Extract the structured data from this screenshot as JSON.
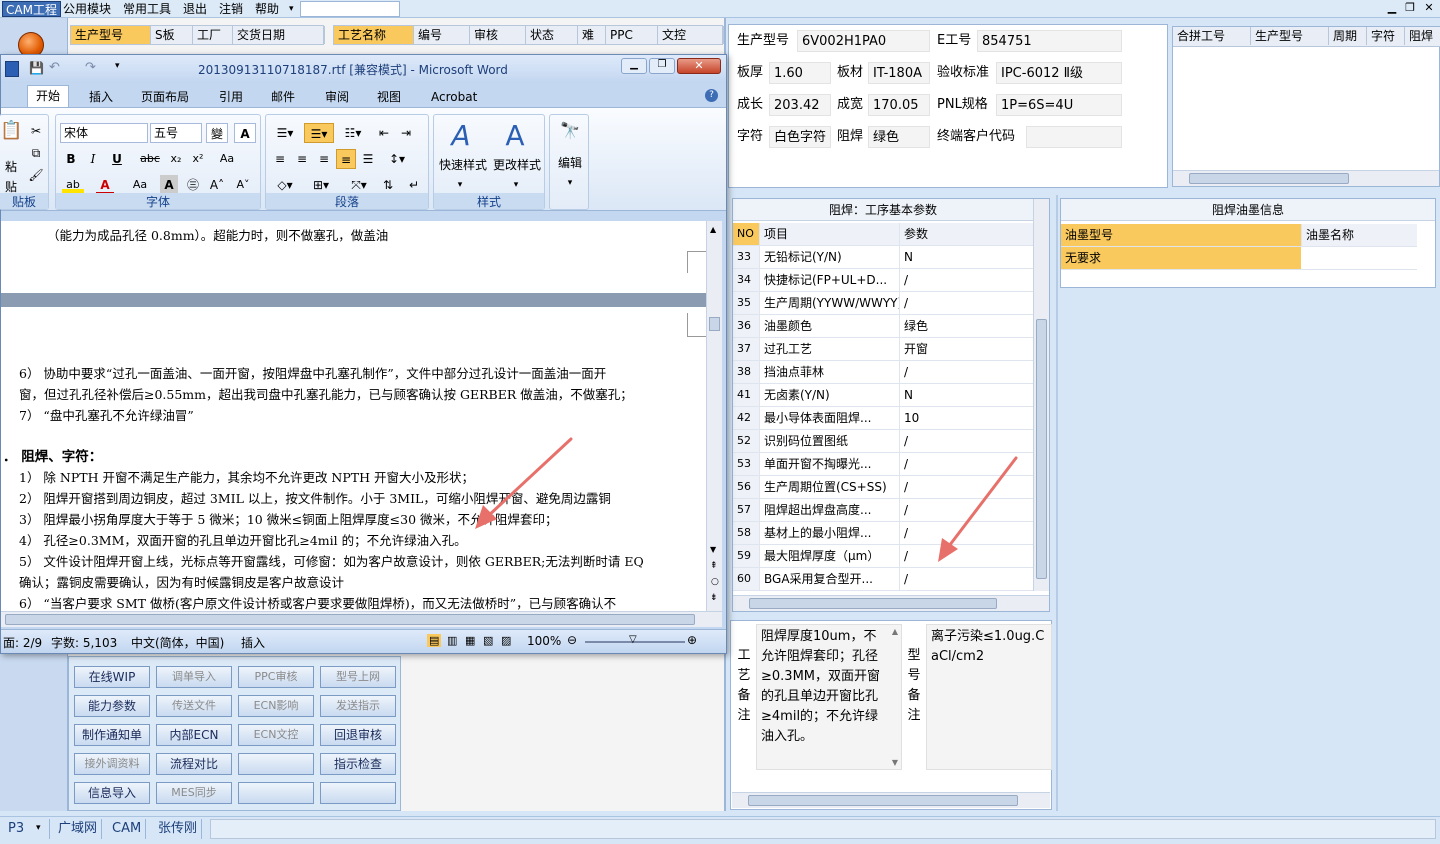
{
  "menubar": {
    "items": [
      "CAM工程",
      "公用模块",
      "常用工具",
      "退出",
      "注销",
      "帮助"
    ]
  },
  "top_grid_left": {
    "headers": [
      "生产型号",
      "S板",
      "工厂",
      "交货日期"
    ]
  },
  "top_grid_right": {
    "headers": [
      "工艺名称",
      "编号",
      "审核",
      "状态",
      "难",
      "PPC",
      "文控"
    ]
  },
  "bottom_buttons": {
    "rows": [
      [
        "在线WIP",
        "调单导入",
        "PPC审核",
        "型号上网"
      ],
      [
        "能力参数",
        "传送文件",
        "ECN影响",
        "发送指示"
      ],
      [
        "制作通知单",
        "内部ECN",
        "ECN文控",
        "回退审核"
      ],
      [
        "接外调资料",
        "流程对比",
        "",
        ""
      ],
      [
        "信息导入",
        "MES同步",
        "",
        ""
      ]
    ],
    "extra": "指示检查"
  },
  "word": {
    "title": "20130913110718187.rtf [兼容模式] - Microsoft Word",
    "tabs": [
      "开始",
      "插入",
      "页面布局",
      "引用",
      "邮件",
      "审阅",
      "视图",
      "Acrobat"
    ],
    "font_name": "宋体",
    "font_size": "五号",
    "group_labels": [
      "贴板",
      "字体",
      "段落",
      "样式"
    ],
    "style_btns": [
      "快速样式",
      "更改样式",
      "编辑"
    ],
    "paste_label": "粘贴",
    "doc_lines": [
      "（能力为成品孔径 0.8mm）。超能力时，则不做塞孔，做盖油",
      "6）  协助中要求“过孔一面盖油、一面开窗，按阻焊盘中孔塞孔制作”，文件中部分过孔设计一面盖油一面开",
      "      窗，但过孔孔径补偿后≥0.55mm，超出我司盘中孔塞孔能力，已与顾客确认按 GERBER 做盖油，不做塞孔；",
      "7）  “盘中孔塞孔不允许绿油冒”",
      "．  阻焊、字符：",
      "1）  除 NPTH 开窗不满足生产能力，其余均不允许更改 NPTH 开窗大小及形状；",
      "2）  阻焊开窗搭到周边铜皮，超过 3MIL 以上，按文件制作。小于 3MIL，可缩小阻焊开窗、避免周边露铜",
      "3）  阻焊最小拐角厚度大于等于 5 微米；10 微米≤铜面上阻焊厚度≤30 微米，不允许阻焊套印；",
      "4）  孔径≥0.3MM，双面开窗的孔且单边开窗比孔≥4mil 的；不允许绿油入孔。",
      "5）  文件设计阻焊开窗上线，光标点等开窗露线，可修窗：如为客户故意设计，则依 GERBER;无法判断时请 EQ",
      "      确认；露铜皮需要确认，因为有时候露铜皮是客户故意设计",
      "6）  “当客户要求 SMT 做桥(客户原文件设计桥或客户要求要做阻焊桥)，而又无法做桥时”，已与顾客确认不"
    ],
    "status": {
      "page": "面: 2/9",
      "words": "字数: 5,103",
      "lang": "中文(简体，中国)",
      "mode": "插入",
      "zoom": "100%"
    }
  },
  "info": {
    "fields": [
      {
        "label": "生产型号",
        "value": "6V002H1PA0"
      },
      {
        "label": "E工号",
        "value": "854751"
      },
      {
        "label": "板厚",
        "value": "1.60"
      },
      {
        "label": "板材",
        "value": "IT-180A"
      },
      {
        "label": "验收标准",
        "value": "IPC-6012 Ⅱ级"
      },
      {
        "label": "成长",
        "value": "203.42"
      },
      {
        "label": "成宽",
        "value": "170.05"
      },
      {
        "label": "PNL规格",
        "value": "1P=6S=4U"
      },
      {
        "label": "字符",
        "value": "白色字符"
      },
      {
        "label": "阻焊",
        "value": "绿色"
      },
      {
        "label": "终端客户代码",
        "value": ""
      }
    ]
  },
  "merge_grid": {
    "headers": [
      "合拼工号",
      "生产型号",
      "周期",
      "字符",
      "阻焊"
    ]
  },
  "process_params": {
    "title": "阻焊：工序基本参数",
    "headers": [
      "NO",
      "项目",
      "参数"
    ],
    "rows": [
      [
        "33",
        "无铅标记(Y/N)",
        "N"
      ],
      [
        "34",
        "快捷标记(FP+UL+D...",
        "/"
      ],
      [
        "35",
        "生产周期(YYWW/WWYY)",
        "/"
      ],
      [
        "36",
        "油墨颜色",
        "绿色"
      ],
      [
        "37",
        "过孔工艺",
        "开窗"
      ],
      [
        "38",
        "挡油点菲林",
        "/"
      ],
      [
        "41",
        "无卤素(Y/N)",
        "N"
      ],
      [
        "42",
        "最小导体表面阻焊...",
        "10"
      ],
      [
        "52",
        "识别码位置图纸",
        "/"
      ],
      [
        "53",
        "单面开窗不掏曝光...",
        "/"
      ],
      [
        "56",
        "生产周期位置(CS+SS)",
        "/"
      ],
      [
        "57",
        "阻焊超出焊盘高度...",
        "/"
      ],
      [
        "58",
        "基材上的最小阻焊...",
        "/"
      ],
      [
        "59",
        "最大阻焊厚度（μm）",
        "/"
      ],
      [
        "60",
        "BGA采用复合型开...",
        "/"
      ]
    ]
  },
  "ink_info": {
    "title": "阻焊油墨信息",
    "headers": [
      "油墨型号",
      "油墨名称"
    ],
    "row": [
      "无要求",
      ""
    ]
  },
  "process_note": {
    "label": "工艺备注",
    "text": "阻焊厚度10um，不允许阻焊套印；孔径≥0.3MM，双面开窗的孔且单边开窗比孔≥4mil的；不允许绿油入孔。"
  },
  "model_note": {
    "label": "型号备注",
    "text": "离子污染≤1.0ug.CaCl/cm2"
  },
  "statusbar": {
    "items": [
      "P3",
      "广域网",
      "CAM",
      "张传刚"
    ]
  },
  "colors": {
    "accent": "#3d6db5",
    "selected_header": "#f9c95e",
    "arrow": "#e8706a"
  }
}
